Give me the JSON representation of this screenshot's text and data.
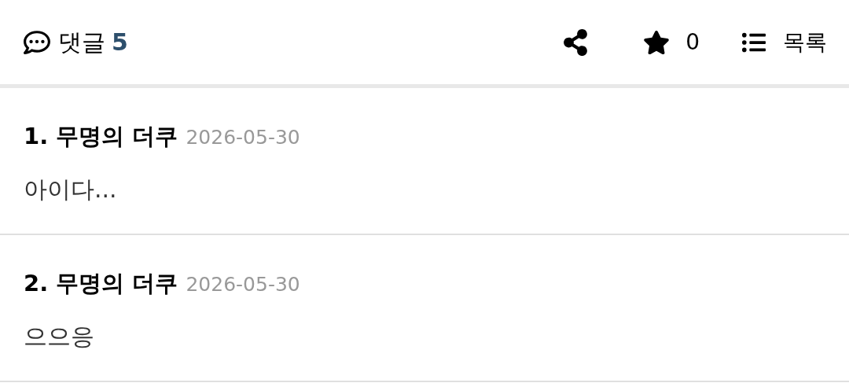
{
  "header": {
    "label": "댓글",
    "count": "5",
    "star_count": "0",
    "list_label": "목록"
  },
  "comments": [
    {
      "number": "1.",
      "author": "무명의 더쿠",
      "date": "2026-05-30",
      "body": "아이다..."
    },
    {
      "number": "2.",
      "author": "무명의 더쿠",
      "date": "2026-05-30",
      "body": "으으응"
    }
  ]
}
